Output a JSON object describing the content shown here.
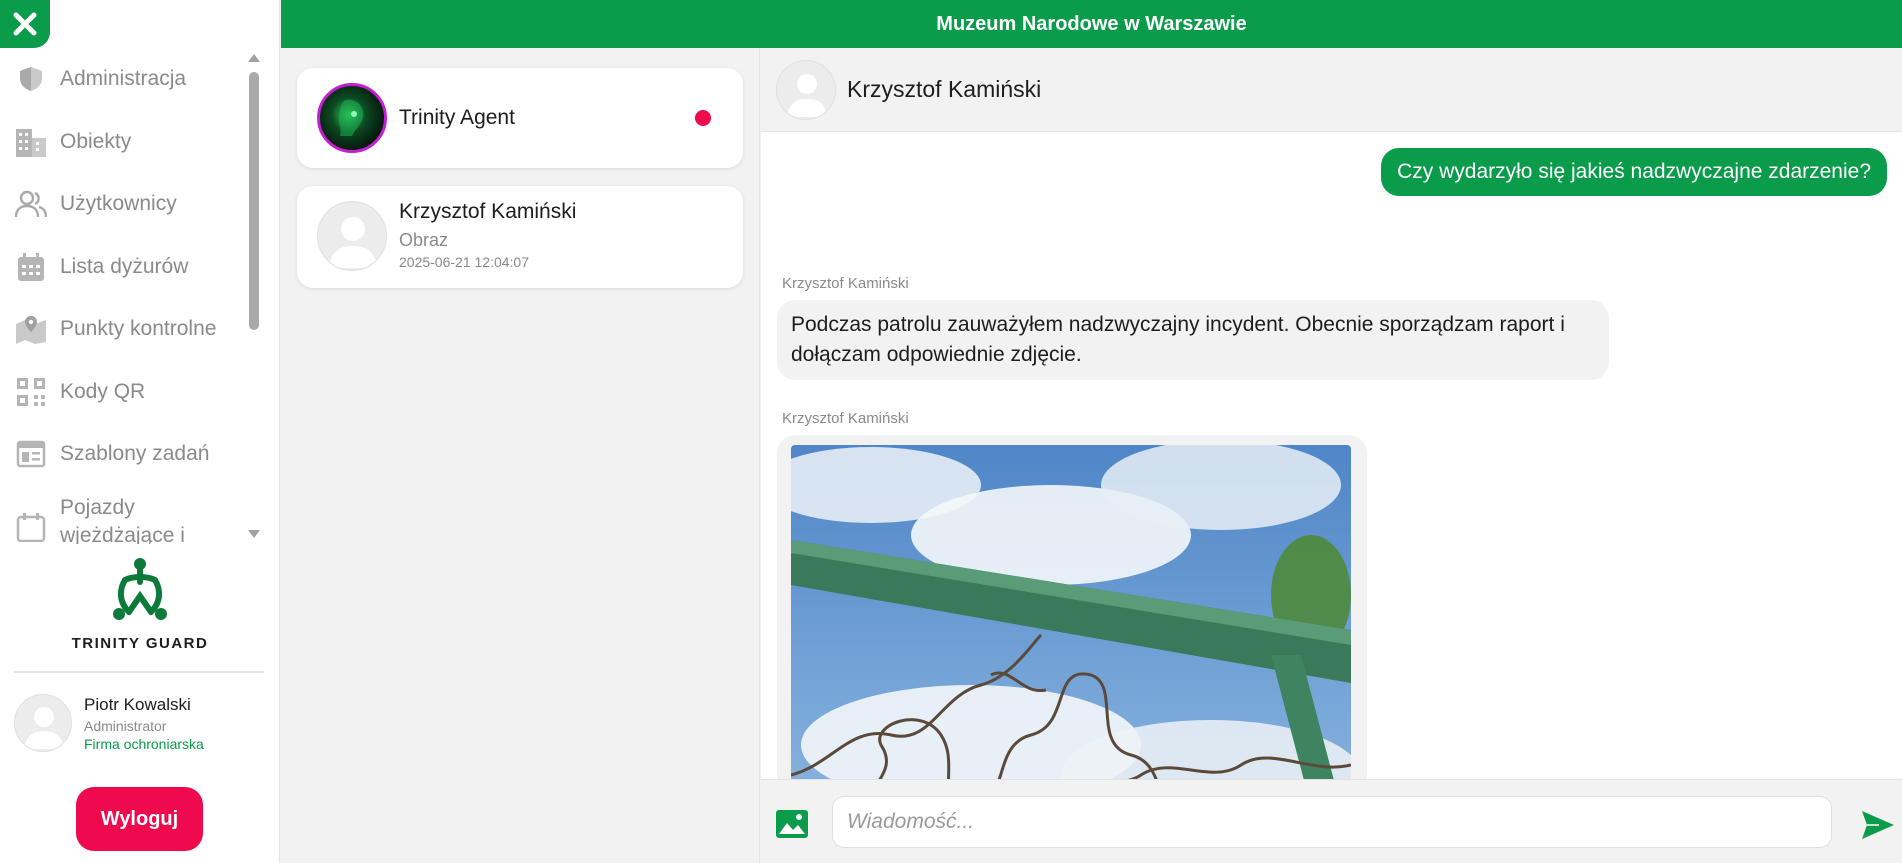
{
  "topbar": {
    "title": "Muzeum Narodowe w Warszawie"
  },
  "sidebar": {
    "items": [
      {
        "label": "Administracja",
        "icon": "shield-icon"
      },
      {
        "label": "Obiekty",
        "icon": "building-icon"
      },
      {
        "label": "Użytkownicy",
        "icon": "users-icon"
      },
      {
        "label": "Lista dyżurów",
        "icon": "calendar-icon"
      },
      {
        "label": "Punkty kontrolne",
        "icon": "map-pin-icon"
      },
      {
        "label": "Kody QR",
        "icon": "qr-code-icon"
      },
      {
        "label": "Szablony zadań",
        "icon": "template-icon"
      },
      {
        "label": "Pojazdy wjeżdżające i",
        "icon": "vehicle-calendar-icon"
      }
    ],
    "brand_name": "TRINITY GUARD",
    "user": {
      "name": "Piotr Kowalski",
      "role": "Administrator",
      "company": "Firma ochroniarska"
    },
    "logout_label": "Wyloguj"
  },
  "conversations": [
    {
      "title": "Trinity Agent",
      "unread": true
    },
    {
      "name": "Krzysztof Kamiński",
      "subtitle": "Obraz",
      "time": "2025-06-21 12:04:07"
    }
  ],
  "chat": {
    "header_name": "Krzysztof Kamiński",
    "messages": {
      "outgoing": "Czy wydarzyło się jakieś nadzwyczajne zdarzenie?",
      "incoming_sender": "Krzysztof Kamiński",
      "incoming_text": "Podczas patrolu zauważyłem nadzwyczajny incydent. Obecnie sporządzam raport i dołączam odpowiednie zdjęcie.",
      "image_sender": "Krzysztof Kamiński"
    },
    "composer": {
      "placeholder": "Wiadomość..."
    }
  },
  "colors": {
    "accent": "#0a9b4b",
    "danger": "#ef0a4d",
    "agent_ring": "#c21fd1"
  }
}
